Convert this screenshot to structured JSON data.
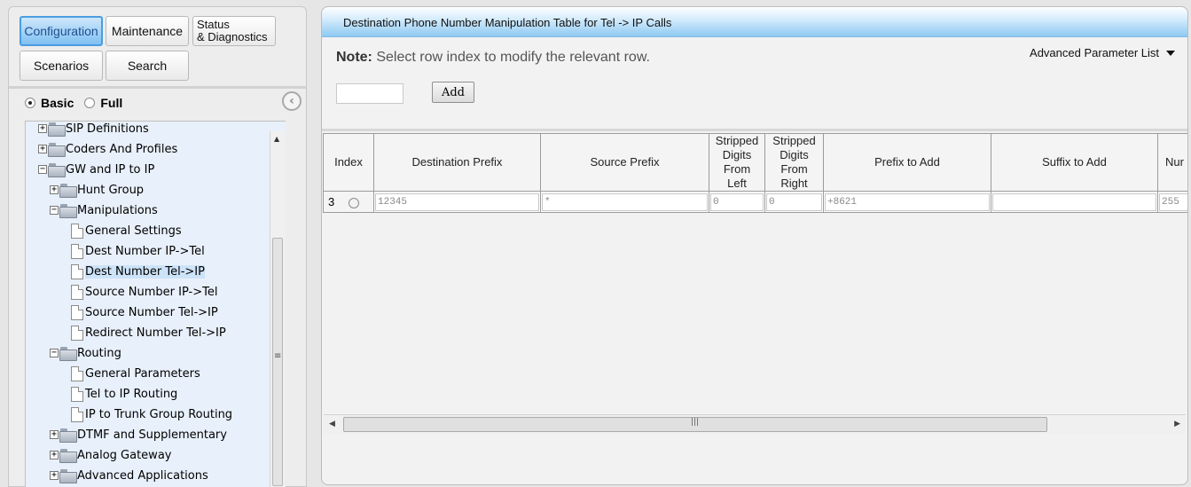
{
  "nav": {
    "configuration": "Configuration",
    "maintenance": "Maintenance",
    "status_line1": "Status",
    "status_line2": "& Diagnostics",
    "scenarios": "Scenarios",
    "search": "Search"
  },
  "mode": {
    "basic": "Basic",
    "full": "Full",
    "selected": "Basic"
  },
  "tree": {
    "items": [
      {
        "label": "SIP Definitions",
        "type": "folder",
        "expander": "+"
      },
      {
        "label": "Coders And Profiles",
        "type": "folder",
        "expander": "+"
      },
      {
        "label": "GW and IP to IP",
        "type": "folder",
        "expander": "−"
      },
      {
        "label": "Hunt Group",
        "type": "folder",
        "expander": "+"
      },
      {
        "label": "Manipulations",
        "type": "folder",
        "expander": "−"
      },
      {
        "label": "General Settings",
        "type": "page"
      },
      {
        "label": "Dest Number IP->Tel",
        "type": "page"
      },
      {
        "label": "Dest Number Tel->IP",
        "type": "page",
        "selected": true
      },
      {
        "label": "Source Number IP->Tel",
        "type": "page"
      },
      {
        "label": "Source Number Tel->IP",
        "type": "page"
      },
      {
        "label": "Redirect Number Tel->IP",
        "type": "page"
      },
      {
        "label": "Routing",
        "type": "folder",
        "expander": "−"
      },
      {
        "label": "General Parameters",
        "type": "page"
      },
      {
        "label": "Tel to IP Routing",
        "type": "page"
      },
      {
        "label": "IP to Trunk Group Routing",
        "type": "page"
      },
      {
        "label": "DTMF and Supplementary",
        "type": "folder",
        "expander": "+"
      },
      {
        "label": "Analog Gateway",
        "type": "folder",
        "expander": "+"
      },
      {
        "label": "Advanced Applications",
        "type": "folder",
        "expander": "+"
      }
    ]
  },
  "main": {
    "title": "Destination Phone Number Manipulation Table for Tel -> IP Calls",
    "note_label": "Note:",
    "note_text": "Select row index to modify the relevant row.",
    "advanced_list": "Advanced Parameter List",
    "add_input_value": "",
    "add_button": "Add",
    "columns": {
      "index": "Index",
      "dest_prefix": "Destination Prefix",
      "source_prefix": "Source Prefix",
      "stripped_left_1": "Stripped",
      "stripped_left_2": "Digits",
      "stripped_left_3": "From",
      "stripped_left_4": "Left",
      "stripped_right_1": "Stripped",
      "stripped_right_2": "Digits",
      "stripped_right_3": "From",
      "stripped_right_4": "Right",
      "prefix_add": "Prefix to Add",
      "suffix_add": "Suffix to Add",
      "num": "Nur"
    },
    "row": {
      "index": "3",
      "dest_prefix": "12345",
      "source_prefix": "*",
      "stripped_left": "0",
      "stripped_right": "0",
      "prefix_add": "+8621",
      "suffix_add": "",
      "num": "255"
    }
  }
}
